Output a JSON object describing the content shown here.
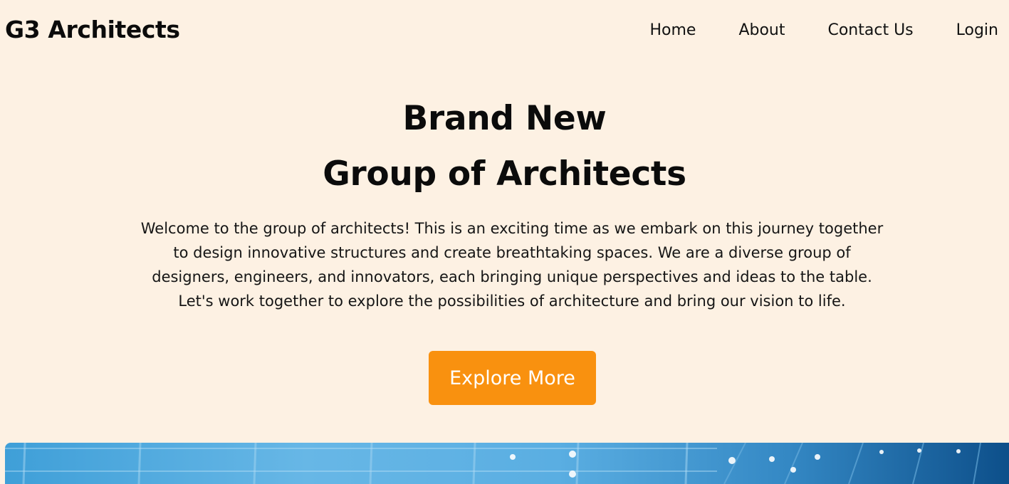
{
  "brand": {
    "name": "G3 Architects"
  },
  "nav": {
    "items": [
      {
        "label": "Home"
      },
      {
        "label": "About"
      },
      {
        "label": "Contact Us"
      },
      {
        "label": "Login"
      }
    ]
  },
  "hero": {
    "title_line_1": "Brand New",
    "title_line_2": "Group of Architects",
    "description": "Welcome to the group of architects! This is an exciting time as we embark on this journey together to design innovative structures and create breathtaking spaces. We are a diverse group of designers, engineers, and innovators, each bringing unique perspectives and ideas to the table. Let's work together to explore the possibilities of architecture and bring our vision to life.",
    "cta_label": "Explore More"
  },
  "colors": {
    "background": "#fdf1e3",
    "accent": "#f9910f",
    "text": "#0b0b0b"
  }
}
